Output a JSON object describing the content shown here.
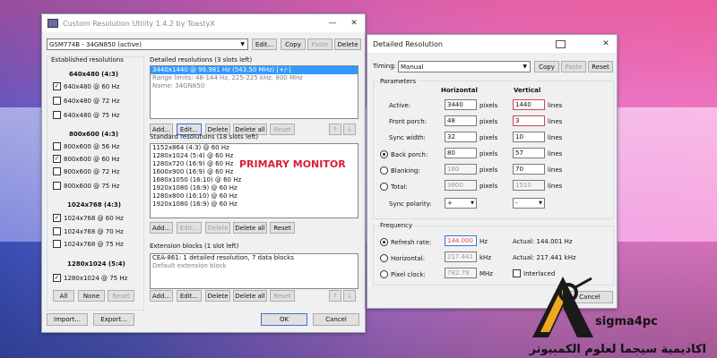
{
  "cru": {
    "title": "Custom Resolution Utility 1.4.2 by ToastyX",
    "monitor": "GSM774B - 34GN850 (active)",
    "top_buttons": [
      "Edit...",
      "Copy",
      "Paste",
      "Delete"
    ],
    "established": {
      "heading": "Established resolutions",
      "groups": [
        {
          "title": "640x480 (4:3)",
          "items": [
            {
              "label": "640x480 @ 60 Hz",
              "checked": true
            },
            {
              "label": "640x480 @ 72 Hz",
              "checked": false
            },
            {
              "label": "640x480 @ 75 Hz",
              "checked": false
            }
          ]
        },
        {
          "title": "800x600 (4:3)",
          "items": [
            {
              "label": "800x600 @ 56 Hz",
              "checked": false
            },
            {
              "label": "800x600 @ 60 Hz",
              "checked": true
            },
            {
              "label": "800x600 @ 72 Hz",
              "checked": false
            },
            {
              "label": "800x600 @ 75 Hz",
              "checked": false
            }
          ]
        },
        {
          "title": "1024x768 (4:3)",
          "items": [
            {
              "label": "1024x768 @ 60 Hz",
              "checked": true
            },
            {
              "label": "1024x768 @ 70 Hz",
              "checked": false
            },
            {
              "label": "1024x768 @ 75 Hz",
              "checked": false
            }
          ]
        },
        {
          "title": "1280x1024 (5:4)",
          "items": [
            {
              "label": "1280x1024 @ 75 Hz",
              "checked": true
            }
          ]
        }
      ],
      "buttons": [
        "All",
        "None",
        "Reset"
      ]
    },
    "detailed": {
      "heading": "Detailed resolutions (3 slots left)",
      "selected": "3440x1440 @ 99.981 Hz (543.50 MHz) [+/-]",
      "range": "Range limits: 48-144 Hz, 225-225 kHz, 800 MHz",
      "name": "Name: 34GN850",
      "buttons": [
        "Add...",
        "Edit...",
        "Delete",
        "Delete all",
        "Reset"
      ]
    },
    "standard": {
      "heading": "Standard resolutions (18 slots left)",
      "items": [
        "1152x864 (4:3) @ 60 Hz",
        "1280x1024 (5:4) @ 60 Hz",
        "1280x720 (16:9) @ 60 Hz",
        "1600x900 (16:9) @ 60 Hz",
        "1680x1050 (16:10) @ 60 Hz",
        "1920x1080 (16:9) @ 60 Hz",
        "1280x800 (16:10) @ 60 Hz",
        "1920x1080 (16:9) @ 60 Hz"
      ],
      "overlay": "PRIMARY MONITOR",
      "buttons": [
        "Add...",
        "Edit...",
        "Delete",
        "Delete all",
        "Reset"
      ]
    },
    "extension": {
      "heading": "Extension blocks (1 slot left)",
      "line1": "CEA-861: 1 detailed resolution, 7 data blocks",
      "line2": "Default extension block",
      "buttons": [
        "Add...",
        "Edit...",
        "Delete",
        "Delete all",
        "Reset"
      ]
    },
    "footer_buttons": [
      "Import...",
      "Export...",
      "OK",
      "Cancel"
    ]
  },
  "detail": {
    "title": "Detailed Resolution",
    "timing_label": "Timing:",
    "timing_value": "Manual",
    "top_buttons": [
      "Copy",
      "Paste",
      "Reset"
    ],
    "params_heading": "Parameters",
    "col_h": "Horizontal",
    "col_v": "Vertical",
    "rows": [
      {
        "label": "Active:",
        "h": "3440",
        "hu": "pixels",
        "v": "1440",
        "vu": "lines"
      },
      {
        "label": "Front porch:",
        "h": "48",
        "hu": "pixels",
        "v": "3",
        "vu": "lines"
      },
      {
        "label": "Sync width:",
        "h": "32",
        "hu": "pixels",
        "v": "10",
        "vu": "lines"
      },
      {
        "label": "Back porch:",
        "h": "80",
        "hu": "pixels",
        "v": "57",
        "vu": "lines"
      },
      {
        "label": "Blanking:",
        "h": "160",
        "hu": "pixels",
        "v": "70",
        "vu": "lines"
      },
      {
        "label": "Total:",
        "h": "3600",
        "hu": "pixels",
        "v": "1510",
        "vu": "lines"
      }
    ],
    "polarity_label": "Sync polarity:",
    "polarity_h": "+",
    "polarity_v": "-",
    "freq_heading": "Frequency",
    "refresh_label": "Refresh rate:",
    "refresh_value": "144.000",
    "refresh_unit": "Hz",
    "refresh_actual": "Actual: 144.001 Hz",
    "hfreq_label": "Horizontal:",
    "hfreq_value": "217.441",
    "hfreq_unit": "kHz",
    "hfreq_actual": "Actual: 217.441 kHz",
    "pclock_label": "Pixel clock:",
    "pclock_value": "782.79",
    "pclock_unit": "MHz",
    "interlaced_label": "Interlaced",
    "cancel_label": "Cancel"
  },
  "watermark": {
    "brand": "sigma4pc",
    "arabic": "اكاديمية سيجما لعلوم الكمبيوتر"
  }
}
